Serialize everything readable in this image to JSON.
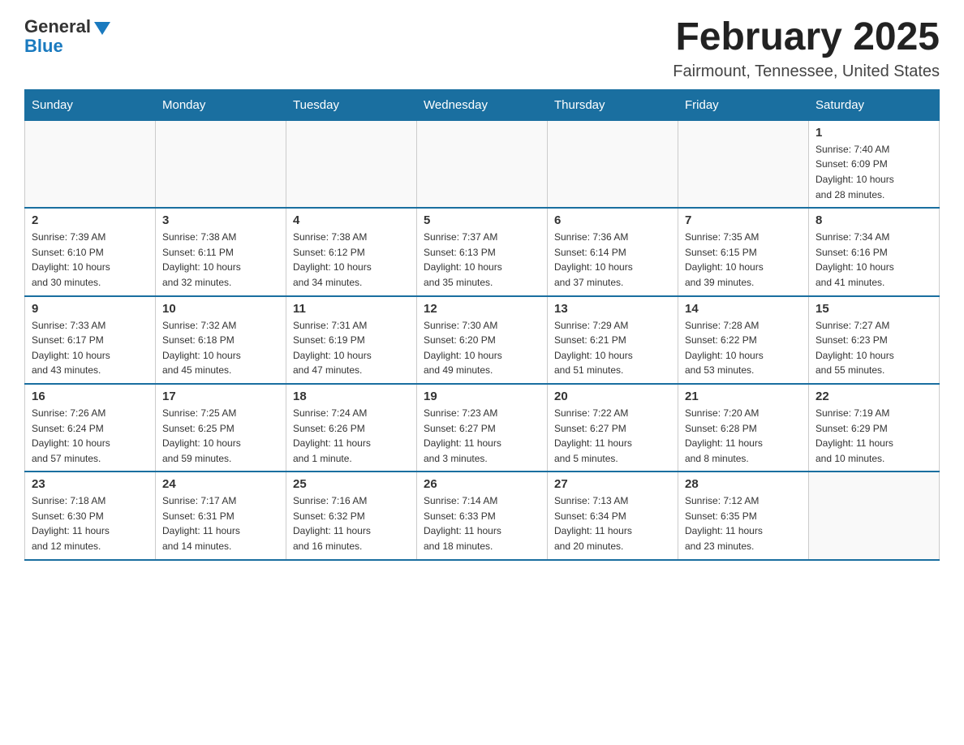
{
  "header": {
    "logo_general": "General",
    "logo_blue": "Blue",
    "month_title": "February 2025",
    "location": "Fairmount, Tennessee, United States"
  },
  "days_of_week": [
    "Sunday",
    "Monday",
    "Tuesday",
    "Wednesday",
    "Thursday",
    "Friday",
    "Saturday"
  ],
  "weeks": [
    [
      {
        "day": "",
        "info": ""
      },
      {
        "day": "",
        "info": ""
      },
      {
        "day": "",
        "info": ""
      },
      {
        "day": "",
        "info": ""
      },
      {
        "day": "",
        "info": ""
      },
      {
        "day": "",
        "info": ""
      },
      {
        "day": "1",
        "info": "Sunrise: 7:40 AM\nSunset: 6:09 PM\nDaylight: 10 hours\nand 28 minutes."
      }
    ],
    [
      {
        "day": "2",
        "info": "Sunrise: 7:39 AM\nSunset: 6:10 PM\nDaylight: 10 hours\nand 30 minutes."
      },
      {
        "day": "3",
        "info": "Sunrise: 7:38 AM\nSunset: 6:11 PM\nDaylight: 10 hours\nand 32 minutes."
      },
      {
        "day": "4",
        "info": "Sunrise: 7:38 AM\nSunset: 6:12 PM\nDaylight: 10 hours\nand 34 minutes."
      },
      {
        "day": "5",
        "info": "Sunrise: 7:37 AM\nSunset: 6:13 PM\nDaylight: 10 hours\nand 35 minutes."
      },
      {
        "day": "6",
        "info": "Sunrise: 7:36 AM\nSunset: 6:14 PM\nDaylight: 10 hours\nand 37 minutes."
      },
      {
        "day": "7",
        "info": "Sunrise: 7:35 AM\nSunset: 6:15 PM\nDaylight: 10 hours\nand 39 minutes."
      },
      {
        "day": "8",
        "info": "Sunrise: 7:34 AM\nSunset: 6:16 PM\nDaylight: 10 hours\nand 41 minutes."
      }
    ],
    [
      {
        "day": "9",
        "info": "Sunrise: 7:33 AM\nSunset: 6:17 PM\nDaylight: 10 hours\nand 43 minutes."
      },
      {
        "day": "10",
        "info": "Sunrise: 7:32 AM\nSunset: 6:18 PM\nDaylight: 10 hours\nand 45 minutes."
      },
      {
        "day": "11",
        "info": "Sunrise: 7:31 AM\nSunset: 6:19 PM\nDaylight: 10 hours\nand 47 minutes."
      },
      {
        "day": "12",
        "info": "Sunrise: 7:30 AM\nSunset: 6:20 PM\nDaylight: 10 hours\nand 49 minutes."
      },
      {
        "day": "13",
        "info": "Sunrise: 7:29 AM\nSunset: 6:21 PM\nDaylight: 10 hours\nand 51 minutes."
      },
      {
        "day": "14",
        "info": "Sunrise: 7:28 AM\nSunset: 6:22 PM\nDaylight: 10 hours\nand 53 minutes."
      },
      {
        "day": "15",
        "info": "Sunrise: 7:27 AM\nSunset: 6:23 PM\nDaylight: 10 hours\nand 55 minutes."
      }
    ],
    [
      {
        "day": "16",
        "info": "Sunrise: 7:26 AM\nSunset: 6:24 PM\nDaylight: 10 hours\nand 57 minutes."
      },
      {
        "day": "17",
        "info": "Sunrise: 7:25 AM\nSunset: 6:25 PM\nDaylight: 10 hours\nand 59 minutes."
      },
      {
        "day": "18",
        "info": "Sunrise: 7:24 AM\nSunset: 6:26 PM\nDaylight: 11 hours\nand 1 minute."
      },
      {
        "day": "19",
        "info": "Sunrise: 7:23 AM\nSunset: 6:27 PM\nDaylight: 11 hours\nand 3 minutes."
      },
      {
        "day": "20",
        "info": "Sunrise: 7:22 AM\nSunset: 6:27 PM\nDaylight: 11 hours\nand 5 minutes."
      },
      {
        "day": "21",
        "info": "Sunrise: 7:20 AM\nSunset: 6:28 PM\nDaylight: 11 hours\nand 8 minutes."
      },
      {
        "day": "22",
        "info": "Sunrise: 7:19 AM\nSunset: 6:29 PM\nDaylight: 11 hours\nand 10 minutes."
      }
    ],
    [
      {
        "day": "23",
        "info": "Sunrise: 7:18 AM\nSunset: 6:30 PM\nDaylight: 11 hours\nand 12 minutes."
      },
      {
        "day": "24",
        "info": "Sunrise: 7:17 AM\nSunset: 6:31 PM\nDaylight: 11 hours\nand 14 minutes."
      },
      {
        "day": "25",
        "info": "Sunrise: 7:16 AM\nSunset: 6:32 PM\nDaylight: 11 hours\nand 16 minutes."
      },
      {
        "day": "26",
        "info": "Sunrise: 7:14 AM\nSunset: 6:33 PM\nDaylight: 11 hours\nand 18 minutes."
      },
      {
        "day": "27",
        "info": "Sunrise: 7:13 AM\nSunset: 6:34 PM\nDaylight: 11 hours\nand 20 minutes."
      },
      {
        "day": "28",
        "info": "Sunrise: 7:12 AM\nSunset: 6:35 PM\nDaylight: 11 hours\nand 23 minutes."
      },
      {
        "day": "",
        "info": ""
      }
    ]
  ]
}
